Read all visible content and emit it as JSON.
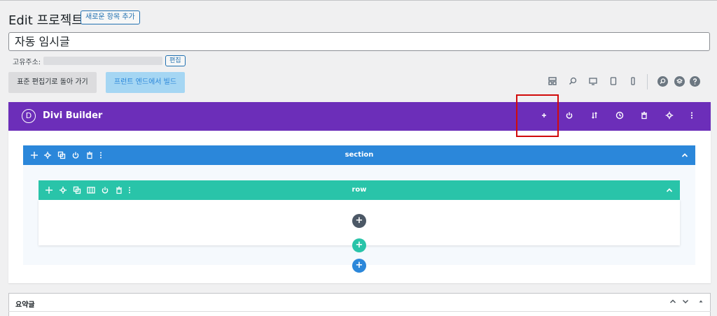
{
  "header": {
    "title": "Edit 프로젝트",
    "add_new_label": "새로운 항목 추가"
  },
  "post": {
    "title_value": "자동 임시글",
    "permalink_label": "고유주소:",
    "permalink_edit_label": "편집"
  },
  "buttons": {
    "classic_editor": "표준 편집기로 돌아 가기",
    "frontend_builder": "프런트 엔드에서 빌드"
  },
  "view_icons": [
    "wireframe-icon",
    "zoom-icon",
    "desktop-icon",
    "tablet-icon",
    "phone-icon"
  ],
  "circle_icons": [
    "search-icon",
    "layers-icon",
    "help-icon"
  ],
  "divi": {
    "logo_letter": "D",
    "title": "Divi Builder",
    "header_icons": [
      "add-icon",
      "power-icon",
      "sort-icon",
      "history-icon",
      "trash-icon",
      "gear-icon",
      "more-icon"
    ],
    "colors": {
      "header": "#6c2eb9",
      "section": "#2b87da",
      "row": "#29c4a9",
      "highlight": "#d10b0b"
    }
  },
  "section": {
    "label": "section"
  },
  "row": {
    "label": "row"
  },
  "excerpt": {
    "title": "요약글"
  }
}
